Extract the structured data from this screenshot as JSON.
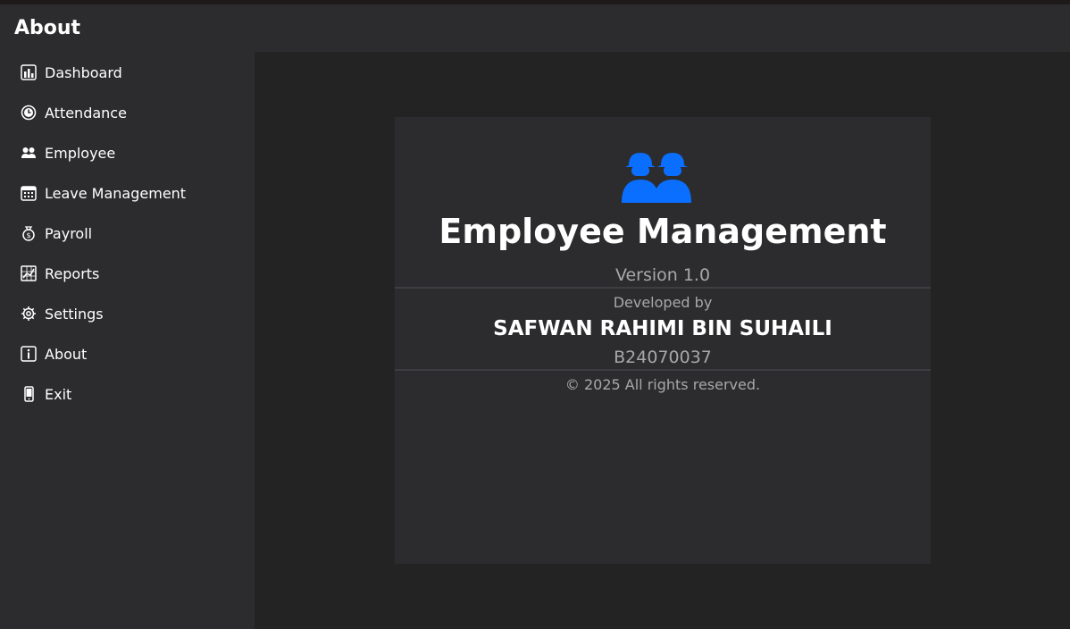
{
  "header": {
    "title": "About"
  },
  "sidebar": {
    "items": [
      {
        "label": "Dashboard",
        "icon": "bar-chart-icon"
      },
      {
        "label": "Attendance",
        "icon": "clock-icon"
      },
      {
        "label": "Employee",
        "icon": "users-icon"
      },
      {
        "label": "Leave Management",
        "icon": "calendar-icon"
      },
      {
        "label": "Payroll",
        "icon": "money-bag-icon"
      },
      {
        "label": "Reports",
        "icon": "chart-icon"
      },
      {
        "label": "Settings",
        "icon": "gear-icon"
      },
      {
        "label": "About",
        "icon": "info-icon"
      },
      {
        "label": "Exit",
        "icon": "phone-icon"
      }
    ]
  },
  "about": {
    "logo_icon": "users-icon",
    "logo_color": "#0a6fff",
    "app_title": "Employee Management",
    "version": "Version 1.0",
    "developed_by": "Developed by",
    "developer_name": "SAFWAN RAHIMI BIN SUHAILI",
    "developer_id": "B24070037",
    "copyright": "© 2025 All rights reserved."
  }
}
